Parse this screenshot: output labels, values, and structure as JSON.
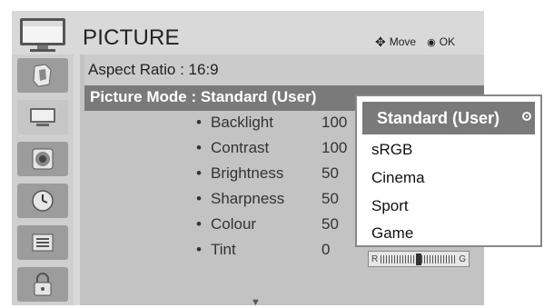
{
  "header": {
    "title": "PICTURE",
    "move_hint": "Move",
    "ok_hint": "OK"
  },
  "sidebar": {
    "items": [
      {
        "icon": "aspect-icon"
      },
      {
        "icon": "picture-icon"
      },
      {
        "icon": "audio-icon"
      },
      {
        "icon": "time-icon"
      },
      {
        "icon": "option-icon"
      },
      {
        "icon": "lock-icon"
      }
    ],
    "active_index": 1
  },
  "menu": {
    "aspect_ratio": "Aspect Ratio   : 16:9",
    "picture_mode": "Picture Mode : Standard (User)",
    "settings": [
      {
        "label": "Backlight",
        "value": "100"
      },
      {
        "label": "Contrast",
        "value": "100"
      },
      {
        "label": "Brightness",
        "value": "50"
      },
      {
        "label": "Sharpness",
        "value": "50"
      },
      {
        "label": "Colour",
        "value": "50"
      },
      {
        "label": "Tint",
        "value": "0"
      }
    ],
    "bullet": "•",
    "tint_left": "R",
    "tint_right": "G",
    "colour_level": 0.5
  },
  "dropdown": {
    "selected": "Standard (User)",
    "options": [
      "sRGB",
      "Cinema",
      "Sport",
      "Game"
    ]
  },
  "colors": {
    "highlight": "#7a7a7a",
    "panel": "#c3c3c3",
    "sidebar_icon_bg": "#9c9c9c"
  }
}
